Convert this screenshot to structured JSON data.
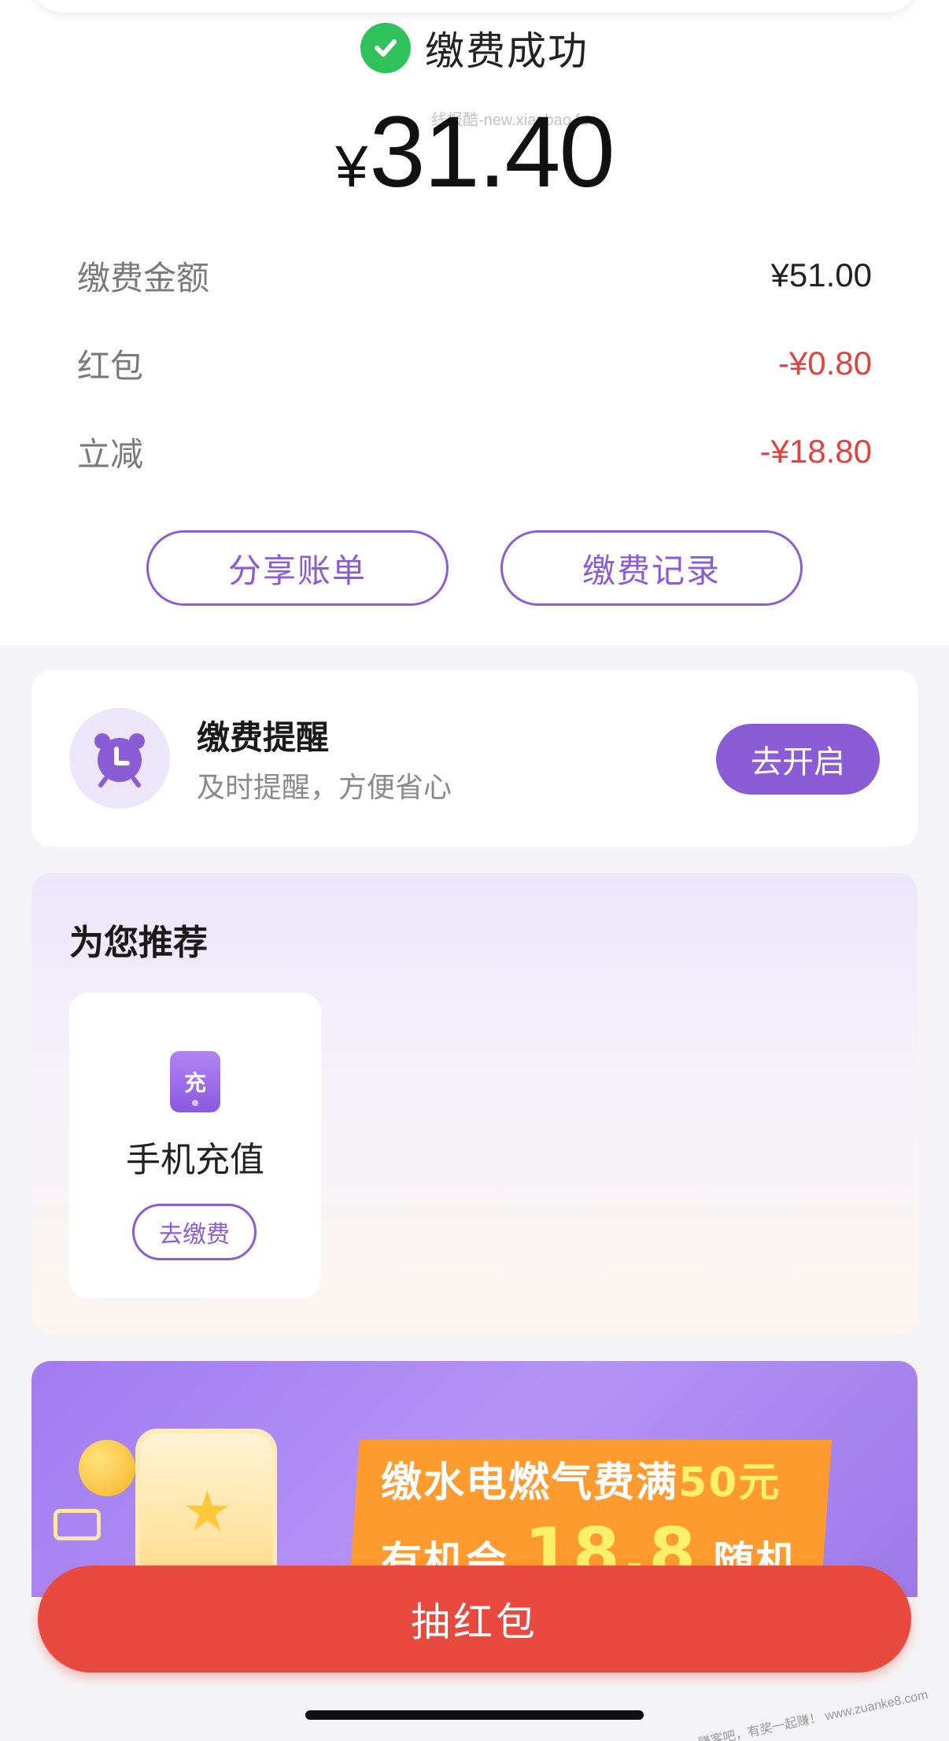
{
  "status": {
    "success_text": "缴费成功"
  },
  "watermark": "线报酷-new.xianbao.fun",
  "payment": {
    "currency": "¥",
    "amount": "31.40",
    "details": [
      {
        "label": "缴费金额",
        "value": "¥51.00",
        "tone": "dark"
      },
      {
        "label": "红包",
        "value": "-¥0.80",
        "tone": "red"
      },
      {
        "label": "立减",
        "value": "-¥18.80",
        "tone": "red"
      }
    ],
    "share_label": "分享账单",
    "records_label": "缴费记录"
  },
  "reminder": {
    "title": "缴费提醒",
    "subtitle": "及时提醒，方便省心",
    "button_label": "去开启"
  },
  "recommend": {
    "title": "为您推荐",
    "items": [
      {
        "icon_text": "充",
        "label": "手机充值",
        "button_label": "去缴费"
      }
    ]
  },
  "banner": {
    "line1_prefix": "缴水电燃气费满",
    "line1_highlight": "50元",
    "line2_prefix": "有机会",
    "line2_big": "18.8",
    "line2_suffix": "随机"
  },
  "bottom_button": {
    "label": "抽红包"
  },
  "corner_watermark": "赚客吧，有奖一起赚！ www.zuanke8.com",
  "colors": {
    "accent": "#8b5cd6",
    "success": "#2fc25b",
    "discount": "#e5413e",
    "cta": "#e94a40"
  },
  "icons": {
    "success": "check-circle-icon",
    "reminder": "alarm-clock-icon",
    "recharge": "phone-recharge-icon"
  }
}
